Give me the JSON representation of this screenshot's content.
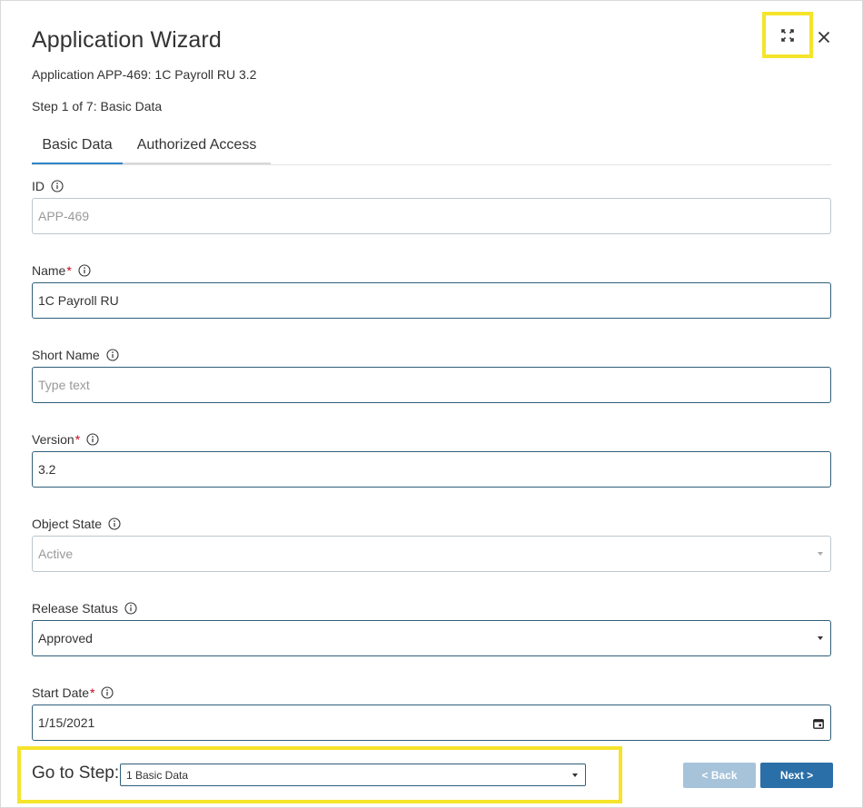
{
  "header": {
    "title": "Application Wizard",
    "subtitle": "Application APP-469: 1C Payroll RU 3.2",
    "step_text": "Step 1 of 7: Basic Data",
    "expand_icon": "expand-icon",
    "close_icon": "close-icon"
  },
  "tabs": [
    {
      "label": "Basic Data",
      "active": true
    },
    {
      "label": "Authorized Access",
      "active": false
    }
  ],
  "fields": {
    "id": {
      "label": "ID",
      "value": "APP-469",
      "disabled": true
    },
    "name": {
      "label": "Name",
      "required": true,
      "value": "1C Payroll RU"
    },
    "short_name": {
      "label": "Short Name",
      "placeholder": "Type text"
    },
    "version": {
      "label": "Version",
      "required": true,
      "value": "3.2"
    },
    "object_state": {
      "label": "Object State",
      "value": "Active",
      "disabled": true
    },
    "release_status": {
      "label": "Release Status",
      "value": "Approved"
    },
    "start_date": {
      "label": "Start Date",
      "required": true,
      "value": "1/15/2021"
    }
  },
  "required_marker": "*",
  "footer": {
    "goto_label": "Go to Step:",
    "goto_value": "1 Basic Data",
    "back_label": "< Back",
    "next_label": "Next >"
  },
  "colors": {
    "accent": "#2e87c8",
    "primary_button": "#2b6fa8",
    "disabled_button": "#a6c3da",
    "required": "#d0021b",
    "highlight": "#f5e42b"
  }
}
